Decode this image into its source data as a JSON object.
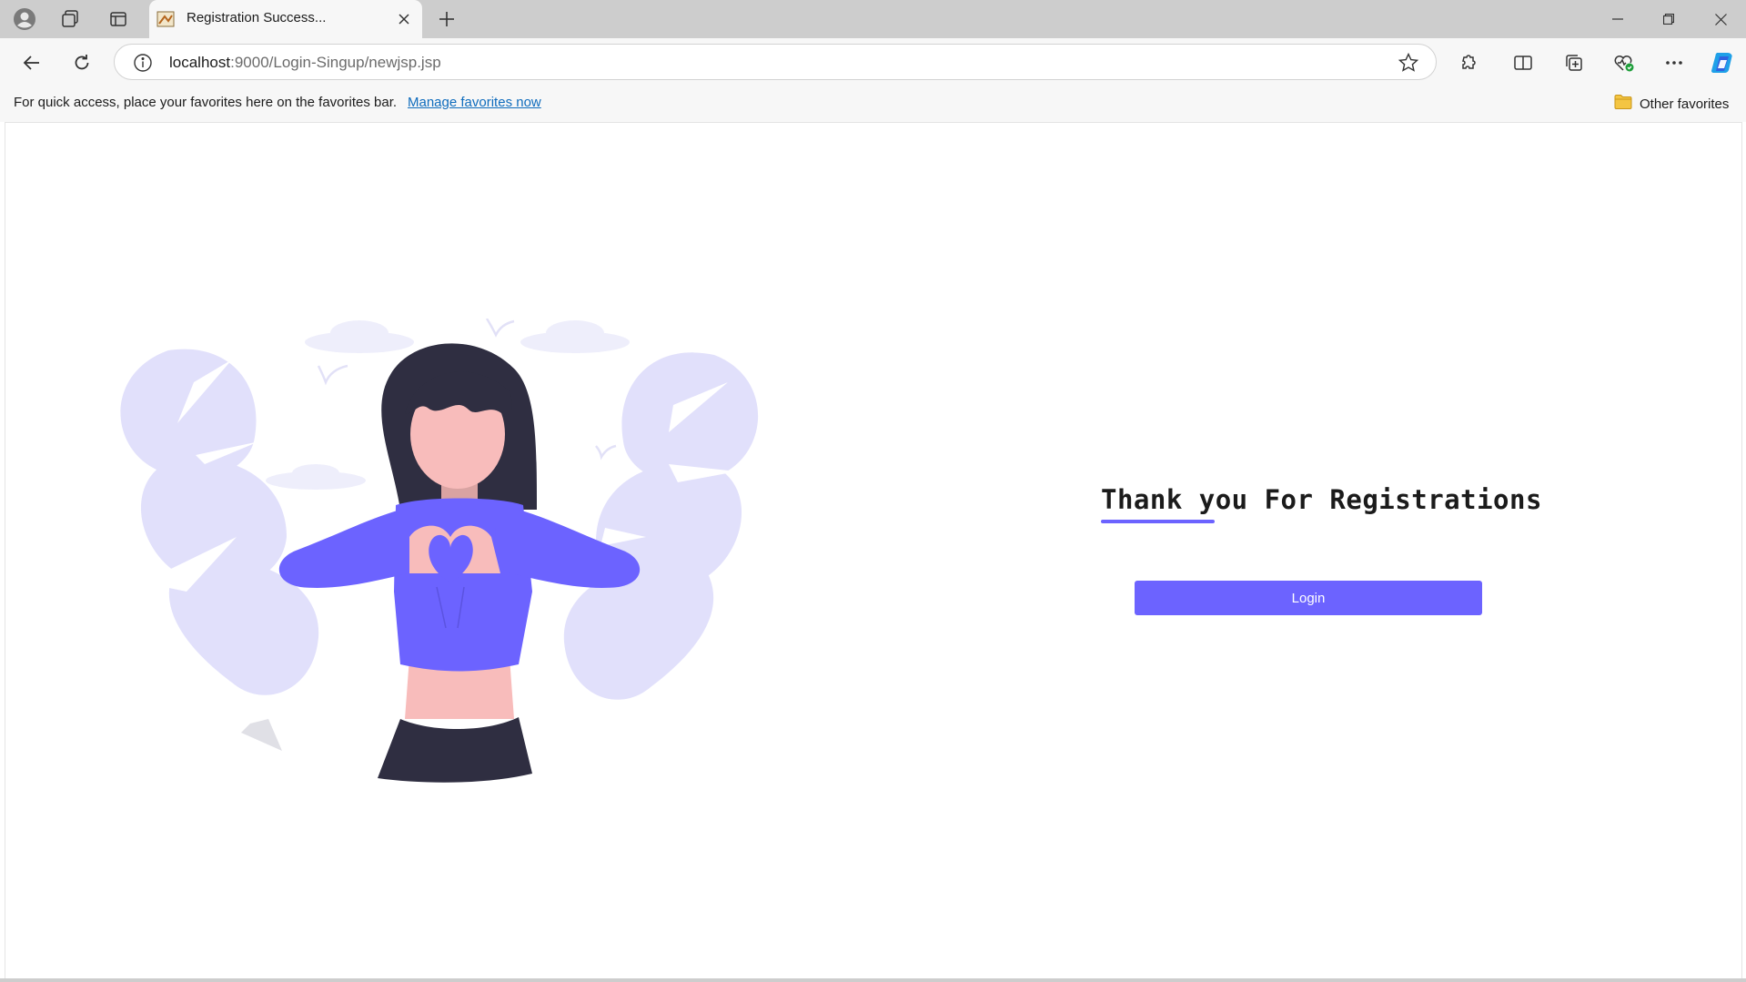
{
  "browser": {
    "tab": {
      "title": "Registration Success..."
    },
    "address_bar": {
      "host": "localhost",
      "path": ":9000/Login-Singup/newjsp.jsp"
    },
    "favorites_bar": {
      "message": "For quick access, place your favorites here on the favorites bar.",
      "manage_link": "Manage favorites now",
      "other_favorites": "Other favorites"
    }
  },
  "page": {
    "heading": "Thank you For Registrations",
    "login_button": "Login",
    "accent_color": "#6c63ff"
  }
}
